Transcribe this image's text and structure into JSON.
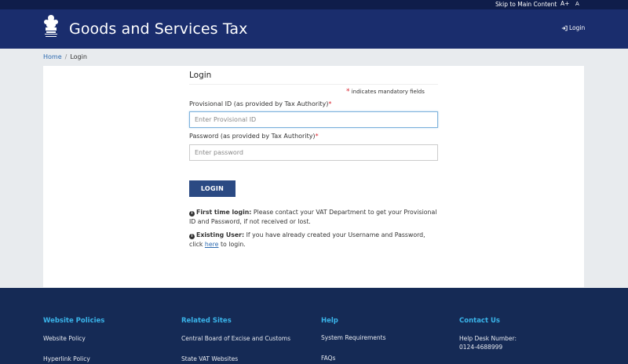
{
  "topbar": {
    "skip_link": "Skip to Main Content",
    "font_increase": "A+",
    "font_normal": "A"
  },
  "header": {
    "title": "Goods and Services Tax",
    "login_link": "Login",
    "emblem_icon": "national-emblem-icon"
  },
  "breadcrumb": {
    "home": "Home",
    "separator": "/",
    "current": "Login"
  },
  "form": {
    "title": "Login",
    "mandatory_note": "indicates mandatory fields",
    "provisional_label": "Provisional ID (as provided by Tax Authority)",
    "provisional_placeholder": "Enter Provisional ID",
    "password_label": "Password (as provided by Tax Authority)",
    "password_placeholder": "Enter password",
    "required_marker": "*",
    "login_button": "LOGIN"
  },
  "info": {
    "first_time_heading": "First time login:",
    "first_time_text": "Please contact your VAT Department to get your Provisional ID and Password, if not received or lost.",
    "existing_heading": "Existing User:",
    "existing_text_before": "If you have already created your Username and Password, click",
    "existing_link": "here",
    "existing_text_after": "to login."
  },
  "footer": {
    "website_policies": {
      "heading": "Website Policies",
      "items": [
        "Website Policy",
        "Hyperlink Policy"
      ]
    },
    "related_sites": {
      "heading": "Related Sites",
      "items": [
        "Central Board of Excise and Customs",
        "State VAT Websites"
      ]
    },
    "help": {
      "heading": "Help",
      "items": [
        "System Requirements",
        "FAQs"
      ]
    },
    "contact": {
      "heading": "Contact Us",
      "help_desk_label": "Help Desk Number:",
      "help_desk_number": "0124-4688999"
    }
  },
  "colors": {
    "topbar": "#0f1d4a",
    "header": "#1a2d6d",
    "button": "#2b4a83",
    "footer": "#152a55",
    "footer_heading": "#3ab4ea",
    "required": "#d9232e",
    "link": "#2e6bb0"
  }
}
